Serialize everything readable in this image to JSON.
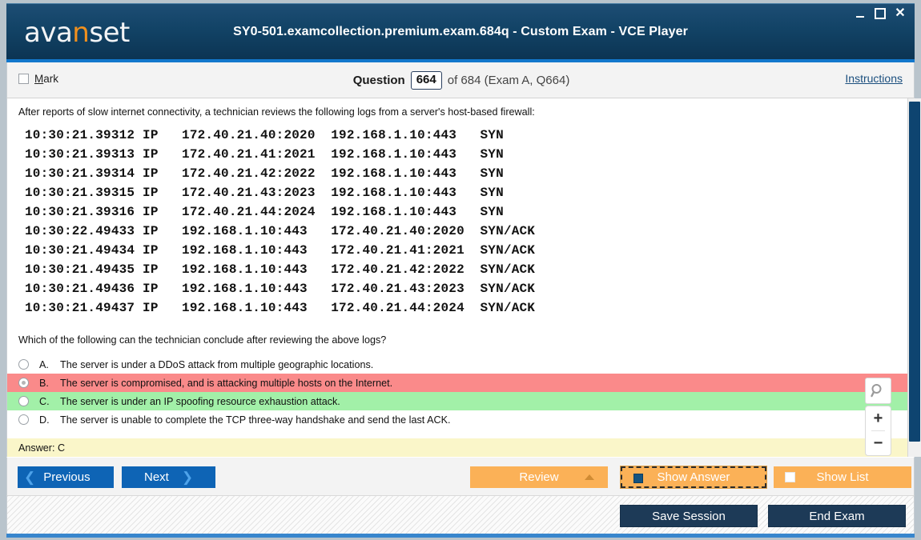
{
  "window": {
    "logo_text_1": "ava",
    "logo_accent": "n",
    "logo_text_2": "set",
    "title": "SY0-501.examcollection.premium.exam.684q - Custom Exam - VCE Player",
    "controls": {
      "minimize": "minimize-icon",
      "maximize": "maximize-icon",
      "close": "✕"
    }
  },
  "header": {
    "mark_label_accel": "M",
    "mark_label_rest": "ark",
    "question_word": "Question",
    "question_number": "664",
    "of_text": "of 684 (Exam A, Q664)",
    "instructions": "Instructions"
  },
  "content": {
    "intro": "After reports of slow internet connectivity, a technician reviews the following logs from a server's host-based firewall:",
    "log_lines": [
      "10:30:21.39312 IP   172.40.21.40:2020  192.168.1.10:443   SYN",
      "10:30:21.39313 IP   172.40.21.41:2021  192.168.1.10:443   SYN",
      "10:30:21.39314 IP   172.40.21.42:2022  192.168.1.10:443   SYN",
      "10:30:21.39315 IP   172.40.21.43:2023  192.168.1.10:443   SYN",
      "10:30:21.39316 IP   172.40.21.44:2024  192.168.1.10:443   SYN",
      "10:30:22.49433 IP   192.168.1.10:443   172.40.21.40:2020  SYN/ACK",
      "10:30:21.49434 IP   192.168.1.10:443   172.40.21.41:2021  SYN/ACK",
      "10:30:21.49435 IP   192.168.1.10:443   172.40.21.42:2022  SYN/ACK",
      "10:30:21.49436 IP   192.168.1.10:443   172.40.21.43:2023  SYN/ACK",
      "10:30:21.49437 IP   192.168.1.10:443   172.40.21.44:2024  SYN/ACK"
    ],
    "prompt": "Which of the following can the technician conclude after reviewing the above logs?",
    "options": [
      {
        "letter": "A.",
        "text": "The server is under a DDoS attack from multiple geographic locations.",
        "selected": false,
        "state": "none"
      },
      {
        "letter": "B.",
        "text": "The server is compromised, and is attacking multiple hosts on the Internet.",
        "selected": true,
        "state": "wrong"
      },
      {
        "letter": "C.",
        "text": "The server is under an IP spoofing resource exhaustion attack.",
        "selected": false,
        "state": "correct"
      },
      {
        "letter": "D.",
        "text": "The server is unable to complete the TCP three-way handshake and send the last ACK.",
        "selected": false,
        "state": "none"
      }
    ],
    "answer_text": "Answer: C",
    "zoom_controls": {
      "magnifier": "magnifier-icon",
      "zoom_in": "+",
      "zoom_out": "−"
    }
  },
  "toolbar": {
    "previous": "Previous",
    "next": "Next",
    "review": "Review",
    "show_answer": "Show Answer",
    "show_list": "Show List",
    "show_answer_checked": true,
    "show_list_checked": false
  },
  "statusbar": {
    "save_session": "Save Session",
    "end_exam": "End Exam"
  },
  "colors": {
    "titlebar": "#124366",
    "accent_blue": "#1277cc",
    "nav_button": "#0e64b5",
    "orange_button": "#fbb157",
    "dark_button": "#1d3a57",
    "wrong_row": "#fa8a8a",
    "correct_row": "#a2f0a8",
    "answer_band": "#faf6c9",
    "logo_accent": "#f0901e"
  }
}
